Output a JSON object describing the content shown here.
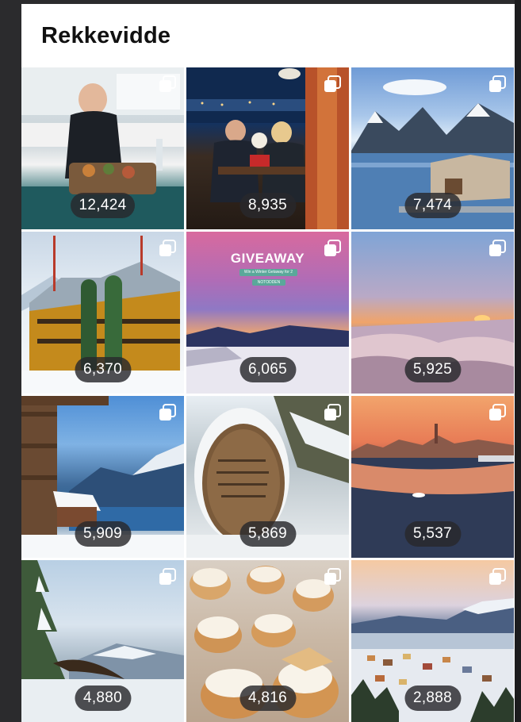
{
  "header": {
    "title": "Rekkevidde"
  },
  "posts": [
    {
      "count": "12,424",
      "icon": "multiple-images-icon"
    },
    {
      "count": "8,935",
      "icon": "multiple-images-icon"
    },
    {
      "count": "7,474",
      "icon": "multiple-images-icon"
    },
    {
      "count": "6,370",
      "icon": "multiple-images-icon"
    },
    {
      "count": "6,065",
      "icon": "multiple-images-icon",
      "overlay_title": "GIVEAWAY",
      "overlay_subtitle": "Win a Winter Getaway for 2",
      "overlay_tag": "NOTODDEN"
    },
    {
      "count": "5,925",
      "icon": "multiple-images-icon"
    },
    {
      "count": "5,909",
      "icon": "multiple-images-icon"
    },
    {
      "count": "5,869",
      "icon": "multiple-images-icon"
    },
    {
      "count": "5,537",
      "icon": "multiple-images-icon"
    },
    {
      "count": "4,880",
      "icon": "multiple-images-icon"
    },
    {
      "count": "4,816",
      "icon": "multiple-images-icon"
    },
    {
      "count": "2,888",
      "icon": "multiple-images-icon"
    }
  ]
}
